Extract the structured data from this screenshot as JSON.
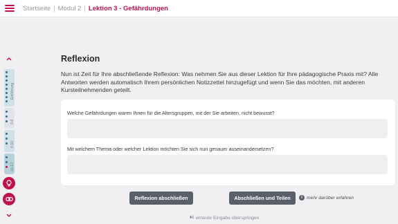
{
  "breadcrumb": {
    "items": [
      "Startseite",
      "Modul 2",
      "Lektion 3 - Gefährdungen"
    ]
  },
  "sidebar": {
    "segments": [
      "Einführung",
      "0-6",
      "6-10",
      "10-13",
      "13-18"
    ]
  },
  "reflexion": {
    "title": "Reflexion",
    "intro": "Nun ist Zeit für Ihre abschließende Reflexion: Was nehmen Sie aus dieser Lektion für Ihre pädagogische Praxis mit? Alle Antworten werden automatisch Ihrem persönlichen Notizzettel hinzugefügt und wenn Sie das möchten, mit anderen Kursteilnehmenden geteilt.",
    "questions": [
      {
        "label": "Welche Gefährdungen waren Ihnen für die Altersgruppen, mit der Sie arbeiten, nicht bewusst?",
        "value": ""
      },
      {
        "label": "Mit welchem Thema oder welcher Lektion möchten Sie sich nun genauer auseinandersetzen?",
        "value": ""
      }
    ]
  },
  "actions": {
    "finish": "Reflexion abschließen",
    "finish_share": "Abschließen und Teilen",
    "learn_more": "mehr darüber erfahren",
    "skip": "erneute Eingabe überspringen"
  },
  "colors": {
    "accent": "#c0114a",
    "button": "#5a6069",
    "background": "#f0f0f2"
  },
  "icons": [
    "menu-icon",
    "chevron-up-icon",
    "chevron-down-icon",
    "lightbulb-icon",
    "link-icon",
    "info-icon",
    "skip-icon"
  ]
}
